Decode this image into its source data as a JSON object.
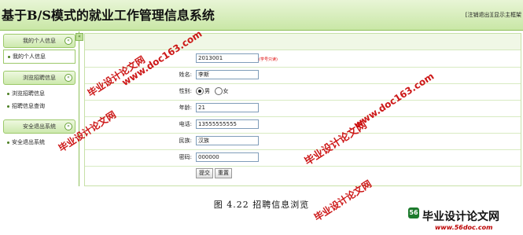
{
  "header": {
    "title": "基于B/S模式的就业工作管理信息系统",
    "logout_link": "[注销退出]",
    "home_link": "[显示主框架"
  },
  "sidebar": {
    "sections": [
      {
        "title": "我的个人信息",
        "items": [
          "我的个人信息"
        ]
      },
      {
        "title": "浏览招聘信息",
        "items": [
          "浏览招聘信息",
          "招聘信息查询"
        ]
      },
      {
        "title": "安全退出系统",
        "items": [
          "安全退出系统"
        ]
      }
    ],
    "toggle_glyph": "«"
  },
  "form": {
    "id_value": "2013001",
    "id_hint": "(学号只读)",
    "name_label": "姓名:",
    "name_value": "李斯",
    "gender_label": "性别:",
    "gender_male": "男",
    "gender_female": "女",
    "gender_selected": "男",
    "age_label": "年龄:",
    "age_value": "21",
    "phone_label": "电话:",
    "phone_value": "13555555555",
    "ethnicity_label": "民族:",
    "ethnicity_value": "汉族",
    "password_label": "密码:",
    "password_value": "000000",
    "submit_label": "提交",
    "reset_label": "重置"
  },
  "caption": "图 4.22 招聘信息浏览",
  "watermarks": {
    "text_cn": "毕业设计论文网",
    "text_url": "www.doc163.com",
    "logo_name": "毕业设计论文网",
    "logo_url": "www.56doc.com",
    "logo_badge": "56"
  },
  "colors": {
    "header_green": "#c9e7a6",
    "border_green": "#8fc05b",
    "watermark_red": "#c80000"
  }
}
